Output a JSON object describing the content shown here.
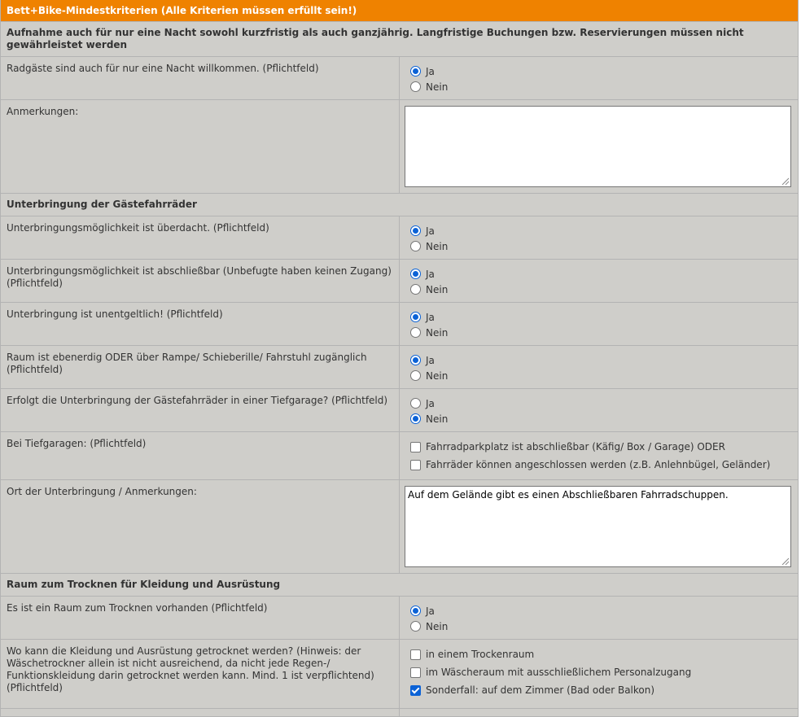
{
  "header": {
    "title": "Bett+Bike-Mindestkriterien (Alle Kriterien müssen erfüllt sein!)"
  },
  "sections": {
    "aufnahme": "Aufnahme auch für nur eine Nacht sowohl kurzfristig als auch ganzjährig. Langfristige Buchungen bzw. Reservierungen müssen nicht gewährleistet werden",
    "unterbringung": "Unterbringung der Gästefahrräder",
    "trocknen": "Raum zum Trocknen für Kleidung und Ausrüstung"
  },
  "options": {
    "ja": "Ja",
    "nein": "Nein"
  },
  "q": {
    "radgaeste": {
      "label": "Radgäste sind auch für nur eine Nacht willkommen. (Pflichtfeld)",
      "selected": "Ja"
    },
    "anmerkungen1": {
      "label": "Anmerkungen:",
      "value": ""
    },
    "ueberdacht": {
      "label": "Unterbringungsmöglichkeit ist überdacht. (Pflichtfeld)",
      "selected": "Ja"
    },
    "abschliessbar": {
      "label": "Unterbringungsmöglichkeit ist abschließbar (Unbefugte haben keinen Zugang) (Pflichtfeld)",
      "selected": "Ja"
    },
    "unentgeltlich": {
      "label": "Unterbringung ist unentgeltlich! (Pflichtfeld)",
      "selected": "Ja"
    },
    "ebenerdig": {
      "label": "Raum ist ebenerdig ODER über Rampe/ Schieberille/ Fahrstuhl zugänglich (Pflichtfeld)",
      "selected": "Ja"
    },
    "tiefgarage": {
      "label": "Erfolgt die Unterbringung der Gästefahrräder in einer Tiefgarage? (Pflichtfeld)",
      "selected": "Nein"
    },
    "bei_tiefgaragen": {
      "label": "Bei Tiefgaragen: (Pflichtfeld)",
      "opt1": "Fahrradparkplatz ist abschließbar (Käfig/ Box / Garage) ODER",
      "opt2": "Fahrräder können angeschlossen werden (z.B. Anlehnbügel, Geländer)",
      "checked": []
    },
    "ort": {
      "label": "Ort der Unterbringung / Anmerkungen:",
      "value": "Auf dem Gelände gibt es einen Abschließbaren Fahrradschuppen."
    },
    "trockenraum": {
      "label": "Es ist ein Raum zum Trocknen vorhanden (Pflichtfeld)",
      "selected": "Ja"
    },
    "wo_trocknen": {
      "label": "Wo kann die Kleidung und Ausrüstung getrocknet werden? (Hinweis: der Wäschetrockner allein ist nicht ausreichend, da nicht jede Regen-/ Funktionskleidung darin getrocknet werden kann. Mind. 1 ist verpflichtend) (Pflichtfeld)",
      "opt1": "in einem Trockenraum",
      "opt2": "im Wäscheraum mit ausschließlichem Personalzugang",
      "opt3": "Sonderfall: auf dem Zimmer (Bad oder Balkon)",
      "checked": [
        "Sonderfall: auf dem Zimmer (Bad oder Balkon)"
      ]
    }
  },
  "colors": {
    "header_bg": "#ef8200",
    "row_bg": "#cfceca",
    "accent": "#0b62d6"
  }
}
